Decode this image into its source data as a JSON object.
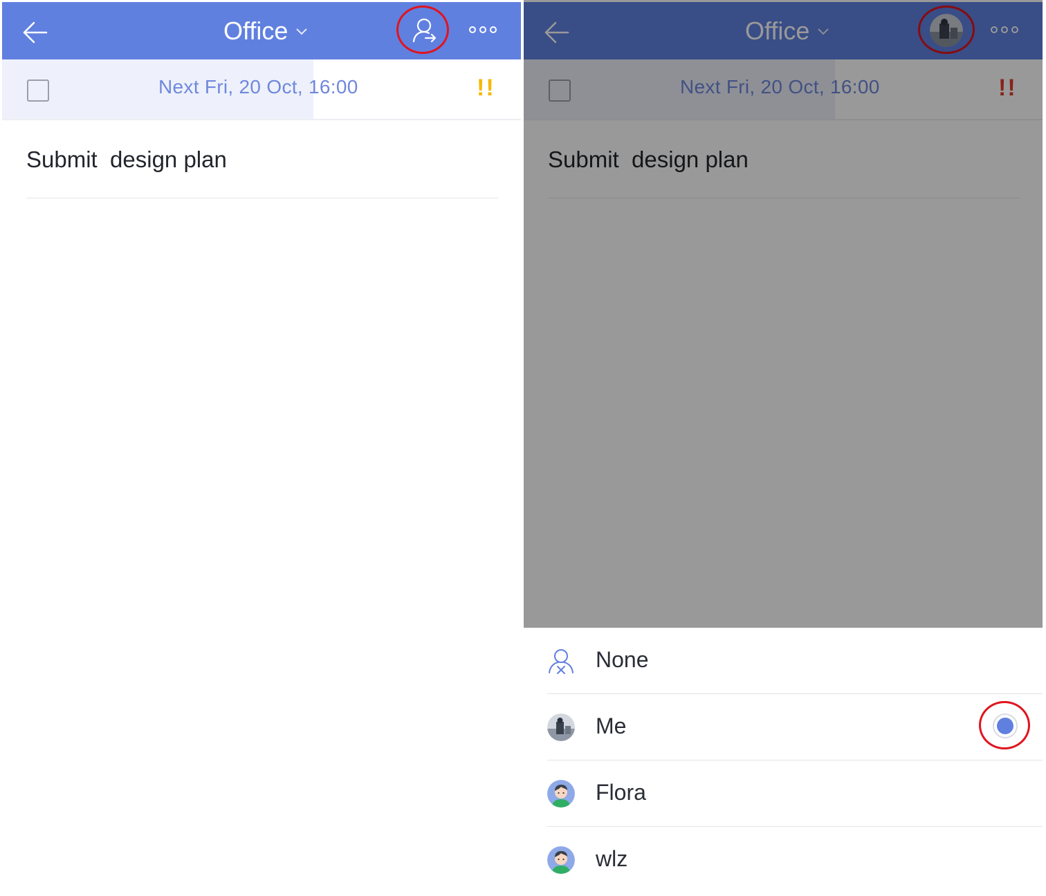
{
  "colors": {
    "accent": "#6080e0",
    "highlight_ring": "#e0141e",
    "priority_medium": "#f5b800",
    "priority_high": "#e03c2e",
    "date_text": "#6f88dc"
  },
  "left_panel": {
    "header": {
      "title": "Office",
      "back_icon": "arrow-left-icon",
      "title_caret_icon": "chevron-down-icon",
      "assignee_icon": "user-assign-icon",
      "more_icon": "more-dots-icon"
    },
    "date_row": {
      "date": "Next Fri, 20 Oct, 16:00",
      "priority": "!!"
    },
    "task": {
      "title": "Submit  design plan"
    }
  },
  "right_panel": {
    "header": {
      "title": "Office",
      "back_icon": "arrow-left-icon",
      "title_caret_icon": "chevron-down-icon",
      "assignee_icon": "avatar-photo",
      "more_icon": "more-dots-icon"
    },
    "date_row": {
      "date": "Next Fri, 20 Oct, 16:00",
      "priority": "!!"
    },
    "task": {
      "title": "Submit  design plan"
    },
    "assignee_sheet": {
      "options": [
        {
          "label": "None",
          "icon": "user-none-icon",
          "selected": false
        },
        {
          "label": "Me",
          "icon": "avatar-photo",
          "selected": true
        },
        {
          "label": "Flora",
          "icon": "avatar-cartoon",
          "selected": false
        },
        {
          "label": "wlz",
          "icon": "avatar-cartoon",
          "selected": false
        }
      ]
    }
  }
}
